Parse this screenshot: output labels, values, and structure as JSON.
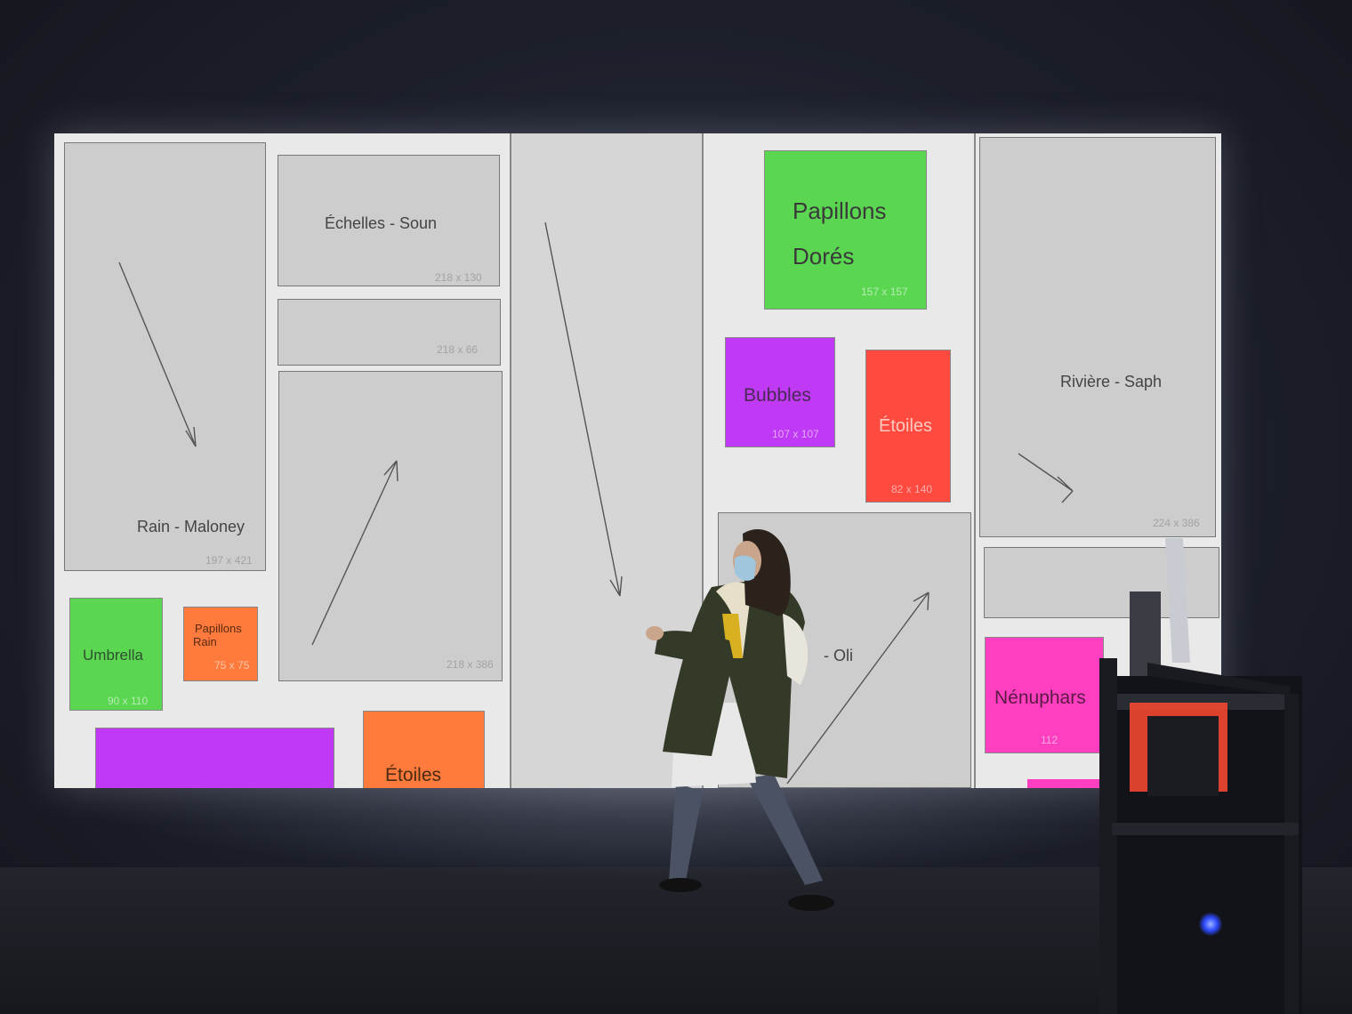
{
  "zones": {
    "rain": {
      "label": "Rain - Maloney",
      "size": "197 x 421"
    },
    "echelles": {
      "label": "Échelles - Soun",
      "size": "218 x 130"
    },
    "small_strip": {
      "size": "218 x 66"
    },
    "tall_mid": {
      "size": "218 x 386"
    },
    "oli": {
      "label": "- Oli"
    },
    "riviere": {
      "label": "Rivière - Saph",
      "size": "224 x 386"
    }
  },
  "tiles": {
    "papillons_dores": {
      "line1": "Papillons",
      "line2": "Dorés",
      "size": "157 x 157",
      "color": "#5ad651"
    },
    "bubbles": {
      "label": "Bubbles",
      "size": "107 x 107",
      "color": "#c03af5"
    },
    "etoiles_red": {
      "label": "Étoiles",
      "size": "82 x 140",
      "color": "#ff4a40"
    },
    "umbrella": {
      "label": "Umbrella",
      "size": "90 x 110",
      "color": "#5ad651"
    },
    "papillons_rain": {
      "line1": "Papillons",
      "line2": "Rain",
      "size": "75 x 75",
      "color": "#ff7a3d"
    },
    "etoiles_orange": {
      "label": "Étoiles",
      "color": "#ff7a3d"
    },
    "purple_bar": {
      "color": "#c03af5"
    },
    "nenuphars": {
      "label": "Nénuphars",
      "size": "112",
      "color": "#ff3fbf"
    }
  }
}
